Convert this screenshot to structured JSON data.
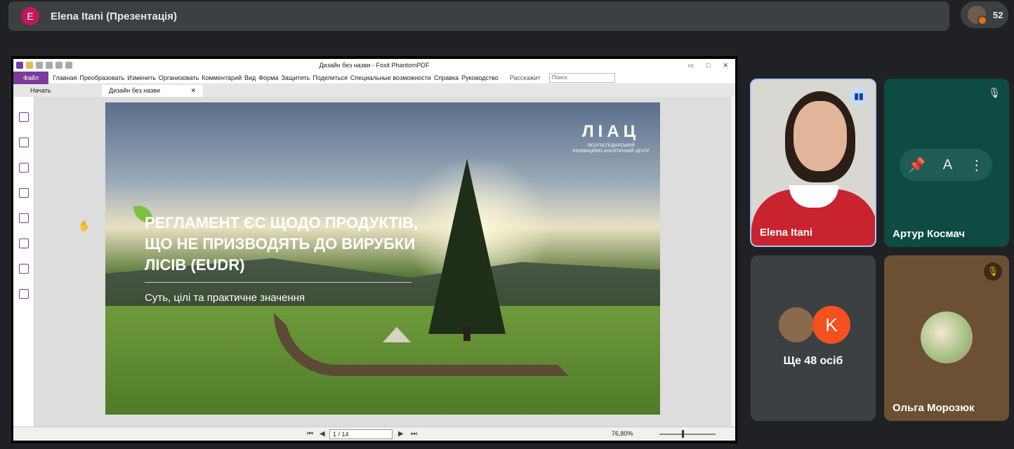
{
  "meet": {
    "presenter_initial": "E",
    "presenter_title": "Elena Itani (Презентація)",
    "participant_count": "52"
  },
  "foxit": {
    "window_title": "Дизайн без назви - Foxit PhantomPDF",
    "menu": {
      "file": "Файл",
      "items": [
        "Главная",
        "Преобразовать",
        "Изменить",
        "Организовать",
        "Комментарий",
        "Вид",
        "Форма",
        "Защитить",
        "Поделиться",
        "Специальные возможности",
        "Справка",
        "Руководство"
      ],
      "tell_me": "Расскажит",
      "search_placeholder": "Поиск"
    },
    "tabs": [
      "Начать",
      "Дизайн без назви"
    ],
    "page_field": "1 / 14",
    "zoom": "76,80%"
  },
  "slide": {
    "logo_main": "ЛІАЦ",
    "logo_sub": "Лісогосподарський інноваційно-аналітичний центр",
    "title": "РЕГЛАМЕНТ ЄС ЩОДО ПРОДУКТІВ,\nЩО НЕ ПРИЗВОДЯТЬ ДО ВИРУБКИ\nЛІСІВ (EUDR)",
    "subtitle": "Суть, цілі та практичне значення"
  },
  "participants": {
    "elena": "Elena Itani",
    "artur": "Артур Космач",
    "more_initial": "K",
    "more": "Ще 48 осіб",
    "olga": "Ольга Морозюк"
  },
  "colors": {
    "meet_bg": "#202124",
    "foxit_brand": "#7a3b9a",
    "speaking_border": "#a8c7fa",
    "artur_tile": "#0e4b43"
  },
  "icons": [
    "hand-cursor-icon",
    "mic-off-icon",
    "pin-icon",
    "captions-icon",
    "more-vert-icon",
    "audio-level-icon"
  ]
}
